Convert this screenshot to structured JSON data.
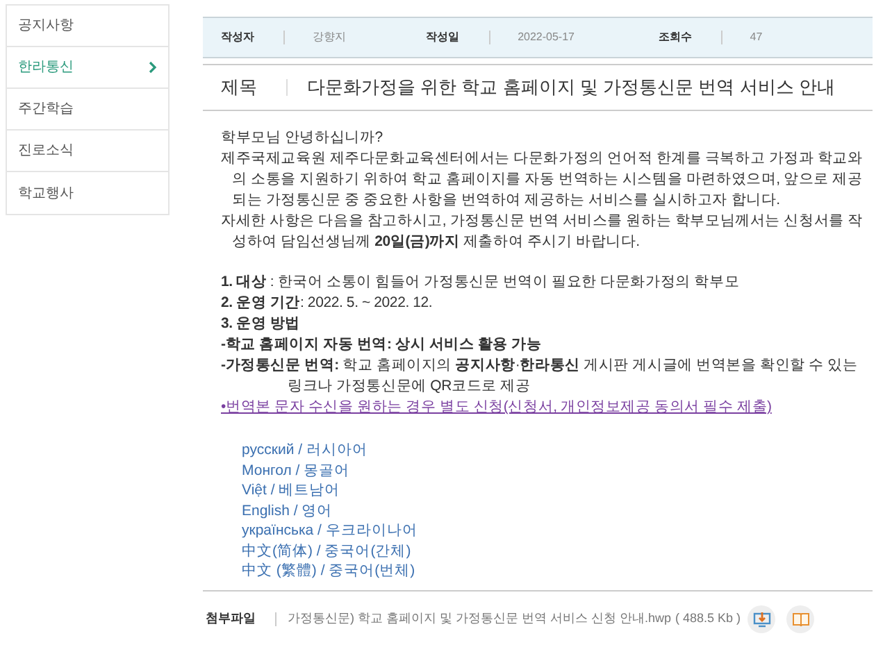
{
  "sidebar": {
    "items": [
      {
        "label": "공지사항",
        "selected": false
      },
      {
        "label": "한라통신",
        "selected": true
      },
      {
        "label": "주간학습",
        "selected": false
      },
      {
        "label": "진로소식",
        "selected": false
      },
      {
        "label": "학교행사",
        "selected": false
      }
    ]
  },
  "meta": [
    {
      "label": "작성자",
      "value": "강향지"
    },
    {
      "label": "작성일",
      "value": "2022-05-17"
    },
    {
      "label": "조회수",
      "value": "47"
    }
  ],
  "subject": {
    "label": "제목",
    "value": "다문화가정을 위한 학교 홈페이지 및 가정통신문 번역 서비스 안내"
  },
  "body": [
    {
      "kind": "text",
      "text": "학부모님 안녕하십니까?"
    },
    {
      "kind": "text",
      "text": "제주국제교육원 제주다문화교육센터에서는 다문화가정의 언어적 한계를 극복하고 가정과 학교와의 소통을 지원하기 위하여 학교 홈페이지를 자동 번역하는 시스템을 마련하였으며, 앞으로 제공되는 가정통신문 중 중요한 사항을 번역하여 제공하는 서비스를 실시하고자 합니다."
    },
    {
      "kind": "text",
      "text": "자세한 사항은 다음을 참고하시고, 가정통신문 번역 서비스를 원하는 학부모님께서는 신청서를 작성하여 담임선생님께 **20일(금)까지** 제출하여 주시기 바랍니다."
    },
    {
      "kind": "gap"
    },
    {
      "kind": "text",
      "text": "**1. 대상** : 한국어 소통이 힘들어 가정통신문 번역이 필요한 다문화가정의 학부모"
    },
    {
      "kind": "text",
      "text": "**2. 운영 기간**: 2022. 5. ~ 2022. 12."
    },
    {
      "kind": "bold",
      "text": "3. 운영 방법"
    },
    {
      "kind": "bold",
      "text": "-학교 홈페이지 자동 번역: 상시 서비스 활용 가능"
    },
    {
      "kind": "indent",
      "text": "**-가정통신문 번역:** 학교 홈페이지의 **공지사항**·**한라통신** 게시판 게시글에 번역본을 확인할 수 있는 링크나 가정통신문에 QR코드로 제공"
    },
    {
      "kind": "link",
      "text": "•번역본 문자 수신을 원하는 경우 별도 신청(신청서, 개인정보제공 동의서 필수 제출)"
    }
  ],
  "languages": [
    "русский / 러시아어",
    "Монгол / 몽골어",
    "Việt / 베트남어",
    "English / 영어",
    "українська / 우크라이나어",
    "中文(简体) / 중국어(간체)",
    "中文 (繁體) / 중국어(번체)"
  ],
  "attachment": {
    "label": "첨부파일",
    "file": "가정통신문) 학교 홈페이지 및 가정통신문 번역 서비스 신청 안내.hwp",
    "size": "( 488.5 Kb )"
  }
}
